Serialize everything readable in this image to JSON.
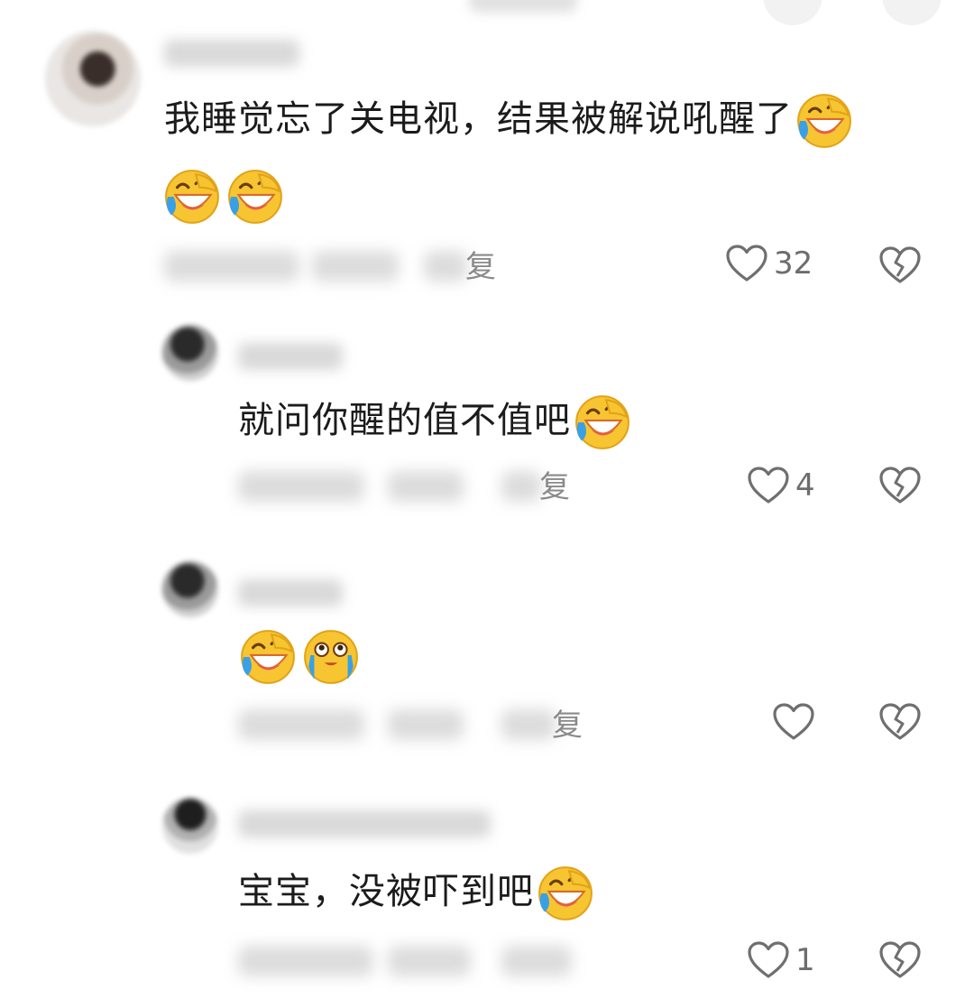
{
  "comments": [
    {
      "text": "我睡觉忘了关电视，结果被解说吼醒了",
      "emojis_inline": [
        "laugh-cry-emoji"
      ],
      "emojis_line2": [
        "laugh-cry-emoji",
        "laugh-cry-emoji"
      ],
      "reply_label": "复",
      "likes": "32"
    },
    {
      "text": "就问你醒的值不值吧",
      "emojis_inline": [
        "laugh-cry-emoji"
      ],
      "reply_label": "复",
      "likes": "4"
    },
    {
      "text": "",
      "emojis_line": [
        "laugh-cry-emoji",
        "tearful-smile-emoji"
      ],
      "reply_label": "复",
      "likes": ""
    },
    {
      "text": "宝宝，没被吓到吧",
      "emojis_inline": [
        "laugh-cry-emoji"
      ],
      "reply_label": "",
      "likes": "1"
    }
  ],
  "colors": {
    "icon_gray": "#6f6f6f",
    "emoji_yellow": "#f7c531",
    "emoji_blue": "#3aa0e6"
  }
}
